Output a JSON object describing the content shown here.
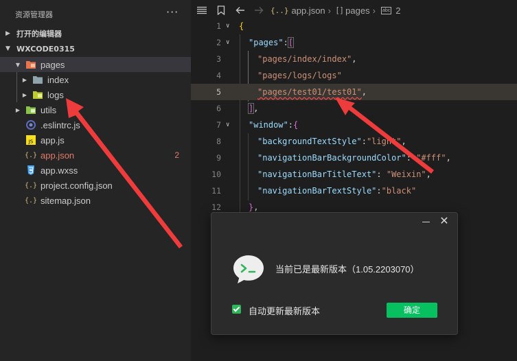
{
  "explorer": {
    "title": "资源管理器",
    "more": "···",
    "open_editors": "打开的编辑器",
    "project": "WXCODE0315",
    "tree": [
      {
        "label": "pages",
        "icon": "folder-pages-icon"
      },
      {
        "label": "index",
        "icon": "folder-icon"
      },
      {
        "label": "logs",
        "icon": "folder-icon"
      },
      {
        "label": "utils",
        "icon": "folder-utils-icon"
      },
      {
        "label": ".eslintrc.js",
        "icon": "eslint-icon"
      },
      {
        "label": "app.js",
        "icon": "js-file-icon"
      },
      {
        "label": "app.json",
        "icon": "json-file-icon",
        "badge": "2"
      },
      {
        "label": "app.wxss",
        "icon": "css-file-icon"
      },
      {
        "label": "project.config.json",
        "icon": "json-file-icon"
      },
      {
        "label": "sitemap.json",
        "icon": "json-file-icon"
      }
    ]
  },
  "breadcrumb": {
    "json_icon": "{..}",
    "file": "app.json",
    "bracket_icon": "[ ]",
    "node": "pages",
    "line_icon": "abc",
    "index": "2"
  },
  "code": {
    "line_numbers": [
      "1",
      "2",
      "3",
      "4",
      "5",
      "6",
      "7",
      "8",
      "9",
      "10",
      "11",
      "12"
    ],
    "current_line": 5,
    "l1": "{",
    "l2_key": "\"pages\"",
    "l2_colon": ":",
    "l2_br": "[",
    "l3": "\"pages/index/index\"",
    "l3_comma": ",",
    "l4": "\"pages/logs/logs\"",
    "l5": "\"pages/test01/test01\"",
    "l5_comma": ",",
    "l6_br": "]",
    "l6_comma": ",",
    "l7_key": "\"window\"",
    "l7_colon": ":",
    "l7_br": "{",
    "l8_key": "\"backgroundTextStyle\"",
    "l8_colon": ":",
    "l8_val": "\"light\"",
    "l8_comma": ",",
    "l9_key": "\"navigationBarBackgroundColor\"",
    "l9_colon": ": ",
    "l9_val": "\"#fff\"",
    "l9_comma": ",",
    "l10_key": "\"navigationBarTitleText\"",
    "l10_colon": ": ",
    "l10_val": "\"Weixin\"",
    "l10_comma": ",",
    "l11_key": "\"navigationBarTextStyle\"",
    "l11_colon": ":",
    "l11_val": "\"black\"",
    "l12_br": "}",
    "l12_comma": ","
  },
  "dialog": {
    "message": "当前已是最新版本（1.05.2203070）",
    "checkbox_label": "自动更新最新版本",
    "checkbox_checked": true,
    "confirm": "确定",
    "close": "✕"
  },
  "colors": {
    "accent_green": "#07c160",
    "annotation_red": "#ee3b3b",
    "modified_file": "#e07b6a"
  }
}
